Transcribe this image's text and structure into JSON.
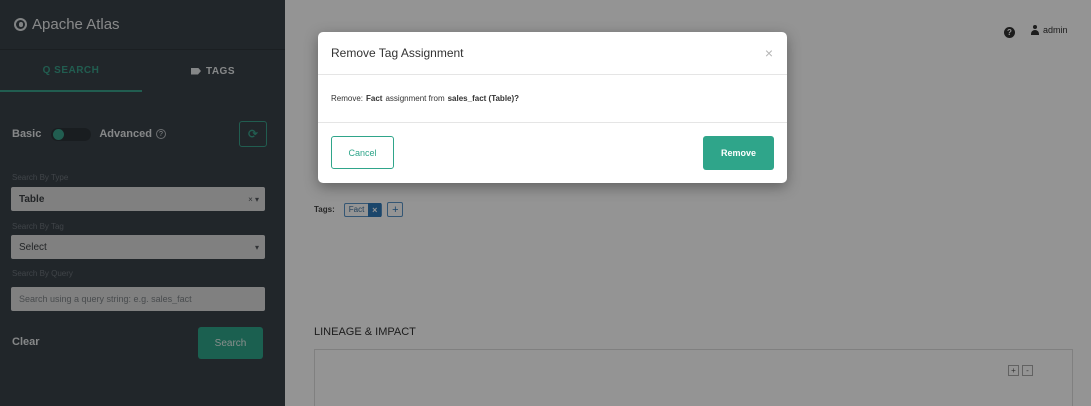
{
  "app": {
    "title": "Apache Atlas"
  },
  "sidebar": {
    "tabs": [
      {
        "label": "Q SEARCH",
        "active": true
      },
      {
        "label": "TAGS",
        "active": false
      }
    ],
    "mode": {
      "basic_label": "Basic",
      "advanced_label": "Advanced",
      "help_glyph": "?",
      "refresh_icon": "refresh-icon"
    },
    "search_by_type": {
      "label": "Search By Type",
      "value": "Table",
      "clear": "×",
      "arrow": "▾"
    },
    "search_by_tag": {
      "label": "Search By Tag",
      "value": "Select",
      "arrow": "▾"
    },
    "search_by_query": {
      "label": "Search By Query",
      "placeholder": "Search using a query string: e.g. sales_fact"
    },
    "clear_label": "Clear",
    "search_button": "Search"
  },
  "header": {
    "help_glyph": "?",
    "user": "admin"
  },
  "entity": {
    "tags_label": "Tags:",
    "tags": [
      "Fact"
    ],
    "remove_glyph": "×",
    "add_glyph": "+"
  },
  "lineage": {
    "title": "LINEAGE & IMPACT",
    "zoom_in": "+",
    "zoom_out": "-"
  },
  "modal": {
    "title": "Remove Tag Assignment",
    "close_glyph": "×",
    "message_prefix": "Remove:",
    "tag_name": "Fact",
    "message_middle": "assignment from",
    "entity_name": "sales_fact (Table)?",
    "cancel_label": "Cancel",
    "remove_label": "Remove"
  },
  "colors": {
    "accent": "#2fa58a",
    "sidebar_bg": "#3a4249",
    "tag_blue": "#2f79b8"
  }
}
